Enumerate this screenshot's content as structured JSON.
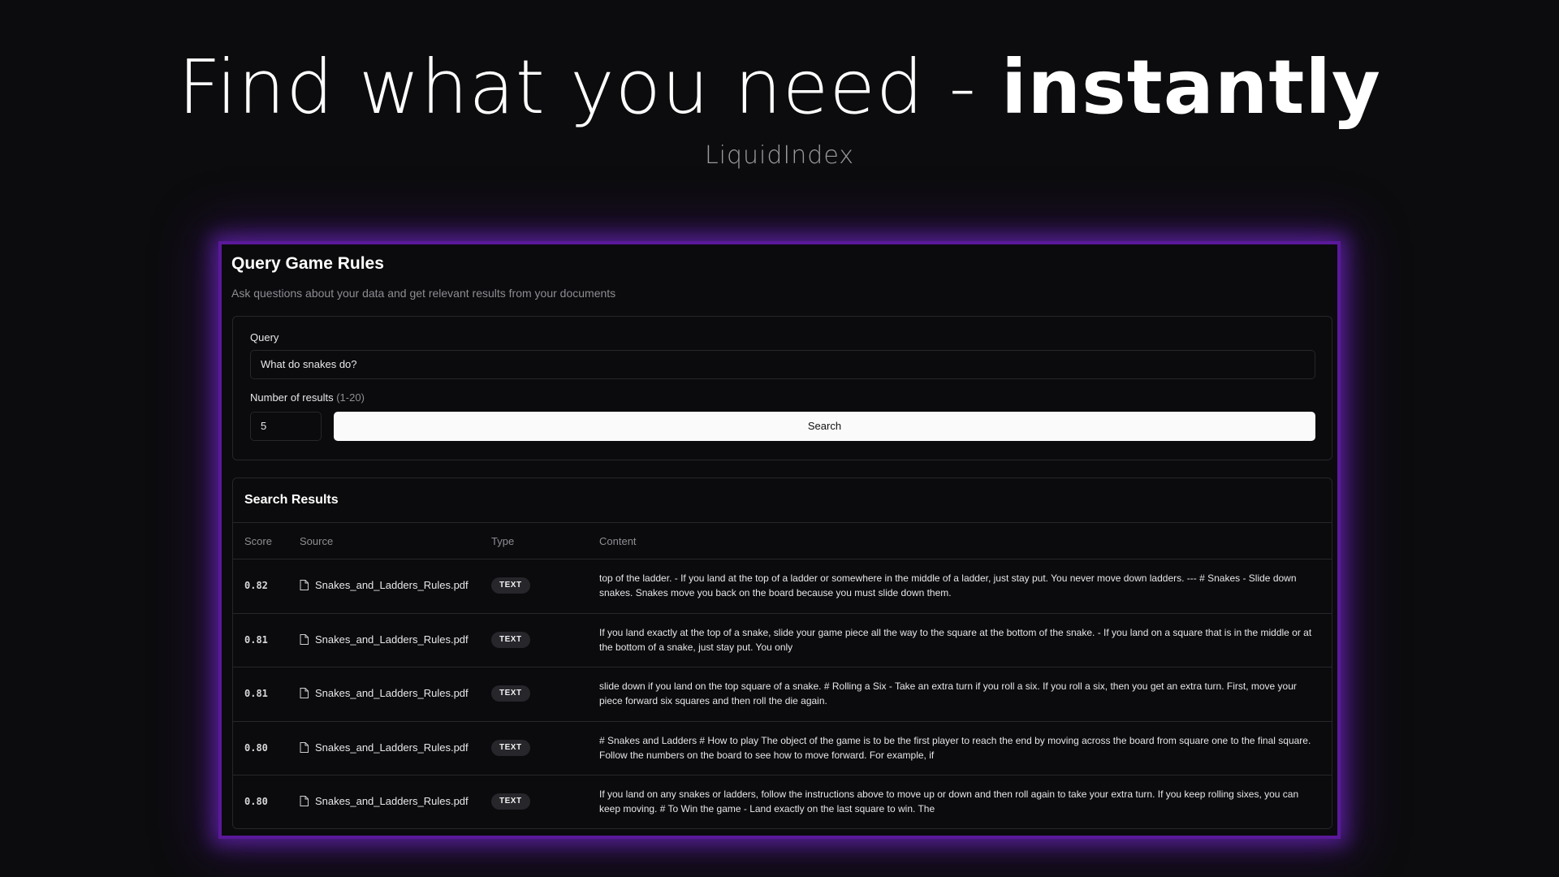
{
  "hero": {
    "headline_light": "Find what you need - ",
    "headline_bold": "instantly",
    "brand": "LiquidIndex"
  },
  "app": {
    "title": "Query Game Rules",
    "subtitle": "Ask questions about your data and get relevant results from your documents"
  },
  "query_form": {
    "query_label": "Query",
    "query_value": "What do snakes do?",
    "results_label": "Number of results",
    "results_hint": "(1-20)",
    "results_value": "5",
    "search_label": "Search"
  },
  "results": {
    "title": "Search Results",
    "columns": [
      "Score",
      "Source",
      "Type",
      "Content"
    ],
    "rows": [
      {
        "score": "0.82",
        "source": "Snakes_and_Ladders_Rules.pdf",
        "type": "TEXT",
        "content": "top of the ladder. - If you land at the top of a ladder or somewhere in the middle of a ladder, just stay put. You never move down ladders. --- # Snakes - Slide down snakes. Snakes move you back on the board because you must slide down them."
      },
      {
        "score": "0.81",
        "source": "Snakes_and_Ladders_Rules.pdf",
        "type": "TEXT",
        "content": "If you land exactly at the top of a snake, slide your game piece all the way to the square at the bottom of the snake. - If you land on a square that is in the middle or at the bottom of a snake, just stay put. You only"
      },
      {
        "score": "0.81",
        "source": "Snakes_and_Ladders_Rules.pdf",
        "type": "TEXT",
        "content": "slide down if you land on the top square of a snake. # Rolling a Six - Take an extra turn if you roll a six. If you roll a six, then you get an extra turn. First, move your piece forward six squares and then roll the die again."
      },
      {
        "score": "0.80",
        "source": "Snakes_and_Ladders_Rules.pdf",
        "type": "TEXT",
        "content": "# Snakes and Ladders # How to play The object of the game is to be the first player to reach the end by moving across the board from square one to the final square. Follow the numbers on the board to see how to move forward. For example, if"
      },
      {
        "score": "0.80",
        "source": "Snakes_and_Ladders_Rules.pdf",
        "type": "TEXT",
        "content": "If you land on any snakes or ladders, follow the instructions above to move up or down and then roll again to take your extra turn. If you keep rolling sixes, you can keep moving. # To Win the game - Land exactly on the last square to win. The"
      }
    ]
  },
  "colors": {
    "background": "#0c0c0e",
    "frame_glow": "#5a189a",
    "button_bg": "#fafafa",
    "badge_bg": "#26262b"
  },
  "icons": {
    "source_file": "file-icon"
  }
}
